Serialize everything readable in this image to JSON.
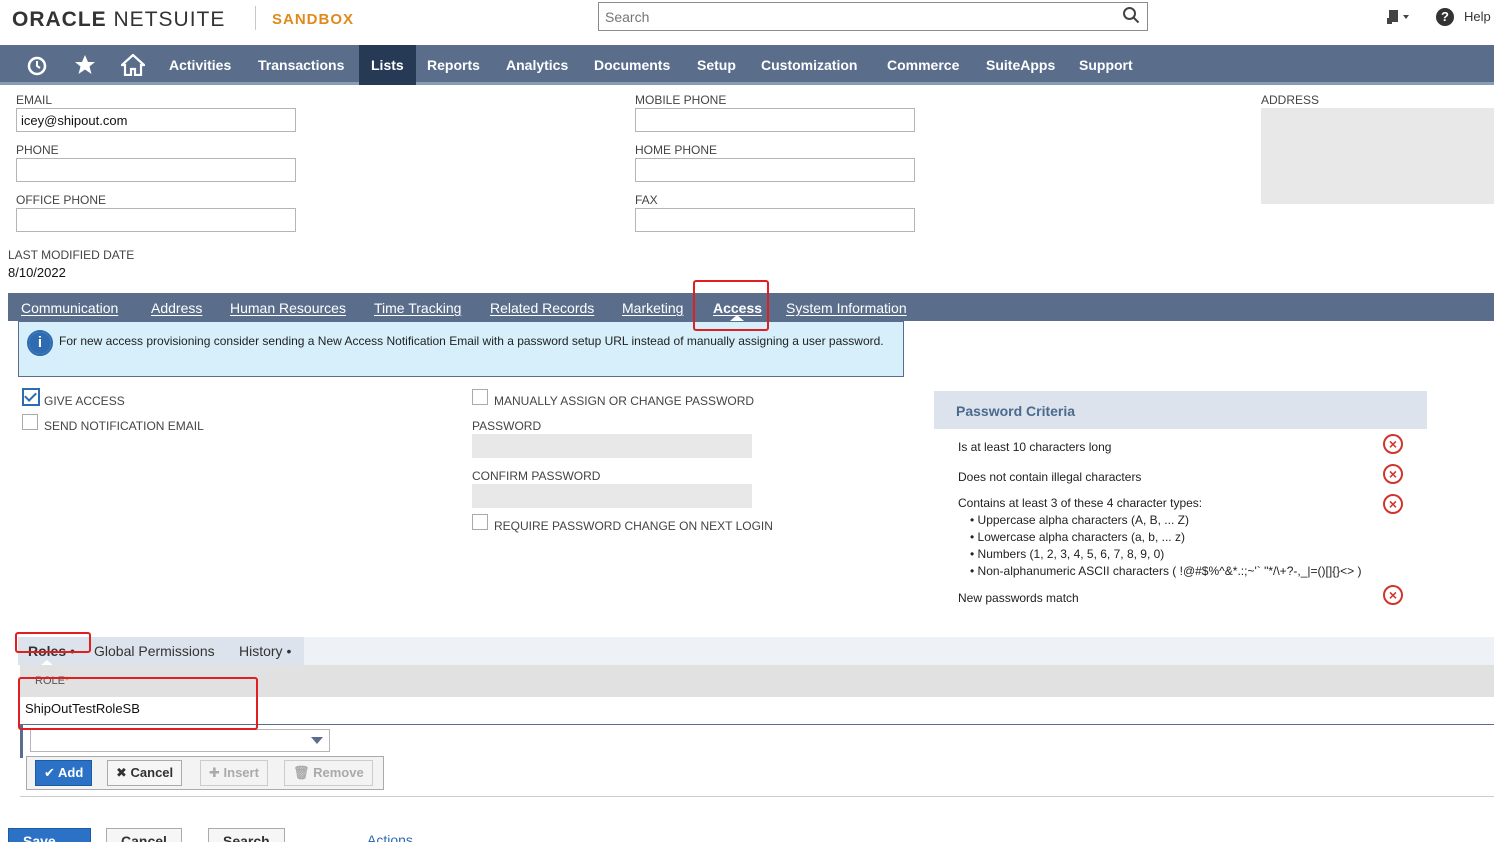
{
  "header": {
    "logo_oracle": "ORACLE",
    "logo_netsuite": "NETSUITE",
    "environment": "SANDBOX",
    "search_placeholder": "Search",
    "help": "Help"
  },
  "nav": {
    "items": [
      "Activities",
      "Transactions",
      "Lists",
      "Reports",
      "Analytics",
      "Documents",
      "Setup",
      "Customization",
      "Commerce",
      "SuiteApps",
      "Support"
    ],
    "active": "Lists"
  },
  "fields": {
    "email_label": "EMAIL",
    "email_value": "icey@shipout.com",
    "phone_label": "PHONE",
    "office_phone_label": "OFFICE PHONE",
    "mobile_phone_label": "MOBILE PHONE",
    "home_phone_label": "HOME PHONE",
    "fax_label": "FAX",
    "address_label": "ADDRESS",
    "last_modified_label": "LAST MODIFIED DATE",
    "last_modified_value": "8/10/2022"
  },
  "tabs": {
    "items": [
      "Communication",
      "Address",
      "Human Resources",
      "Time Tracking",
      "Related Records",
      "Marketing",
      "Access",
      "System Information"
    ],
    "active": "Access"
  },
  "access": {
    "info_text": "For new access provisioning consider sending a New Access Notification Email with a password setup URL instead of manually assigning a user password.",
    "give_access": "GIVE ACCESS",
    "give_access_checked": true,
    "send_notification": "SEND NOTIFICATION EMAIL",
    "manual_password": "MANUALLY ASSIGN OR CHANGE PASSWORD",
    "password_label": "PASSWORD",
    "confirm_password_label": "CONFIRM PASSWORD",
    "require_change": "REQUIRE PASSWORD CHANGE ON NEXT LOGIN"
  },
  "password_criteria": {
    "title": "Password Criteria",
    "items": [
      "Is at least 10 characters long",
      "Does not contain illegal characters",
      "Contains at least 3 of these 4 character types:",
      "New passwords match"
    ],
    "subitems": [
      "• Uppercase alpha characters (A, B, ... Z)",
      "• Lowercase alpha characters (a, b, ... z)",
      "• Numbers (1, 2, 3, 4, 5, 6, 7, 8, 9, 0)",
      "• Non-alphanumeric ASCII characters ( !@#$%^&*.:;~'` \"*/\\+?-,_|=()[]{}<> )"
    ],
    "status_icon": "error-x-icon",
    "status_color": "#d0342c"
  },
  "subtabs": {
    "items": [
      "Roles •",
      "Global Permissions",
      "History •"
    ],
    "active": "Roles •"
  },
  "roles": {
    "column_label": "ROLE",
    "required_mark": "*",
    "rows": [
      "ShipOutTestRoleSB"
    ],
    "buttons": {
      "add": "Add",
      "cancel": "Cancel",
      "insert": "Insert",
      "remove": "Remove"
    }
  },
  "footer": {
    "save": "Save",
    "cancel": "Cancel",
    "search": "Search",
    "actions": "Actions"
  },
  "colors": {
    "nav_bg": "#5a6e8c",
    "nav_active": "#263a56",
    "sandbox": "#e08a1e",
    "primary_button": "#2b72c6",
    "highlight": "#e02020"
  }
}
